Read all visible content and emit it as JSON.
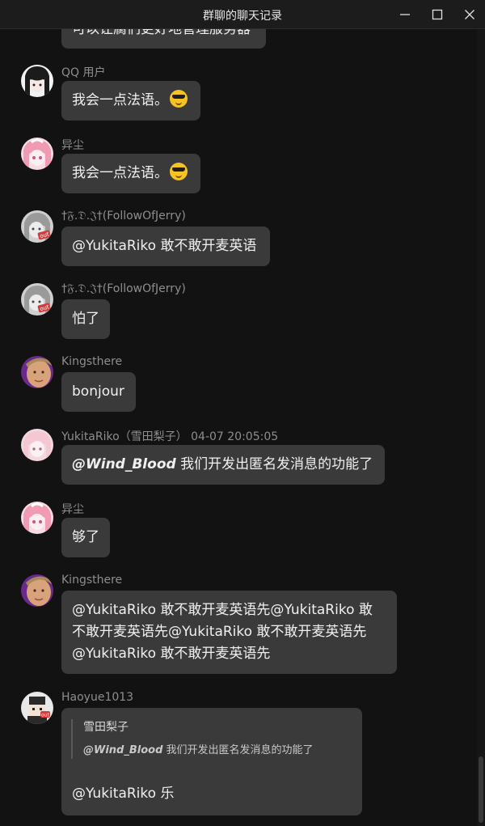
{
  "window": {
    "title": "群聊的聊天记录"
  },
  "messages": [
    {
      "name": "",
      "text": "可以让腐们更好地管理服务器"
    },
    {
      "name": "QQ 用户",
      "text": "我会一点法语。",
      "emoji": "smiling-face-with-sunglasses"
    },
    {
      "name": "异尘",
      "text": "我会一点法语。",
      "emoji": "smiling-face-with-sunglasses"
    },
    {
      "name": "†𝔉.𝔇.𝔍†(FollowOfJerry)",
      "text": "@YukitaRiko 敢不敢开麦英语"
    },
    {
      "name": "†𝔉.𝔇.𝔍†(FollowOfJerry)",
      "text": "怕了"
    },
    {
      "name": "Kingsthere",
      "text": "bonjour"
    },
    {
      "name": "YukitaRiko（雪田梨子） 04-07 20:05:05",
      "mention": "@Wind_Blood",
      "text": " 我们开发出匿名发消息的功能了"
    },
    {
      "name": "异尘",
      "text": "够了"
    },
    {
      "name": "Kingsthere",
      "lines": [
        "@YukitaRiko 敢不敢开麦英语先@YukitaRiko 敢",
        "不敢开麦英语先@YukitaRiko 敢不敢开麦英语先",
        "@YukitaRiko 敢不敢开麦英语先"
      ]
    },
    {
      "name": "Haoyue1013",
      "quote_name": "雪田梨子",
      "quote_mention": "@Wind_Blood",
      "quote_text": " 我们开发出匿名发消息的功能了",
      "text": "@YukitaRiko 乐"
    }
  ]
}
